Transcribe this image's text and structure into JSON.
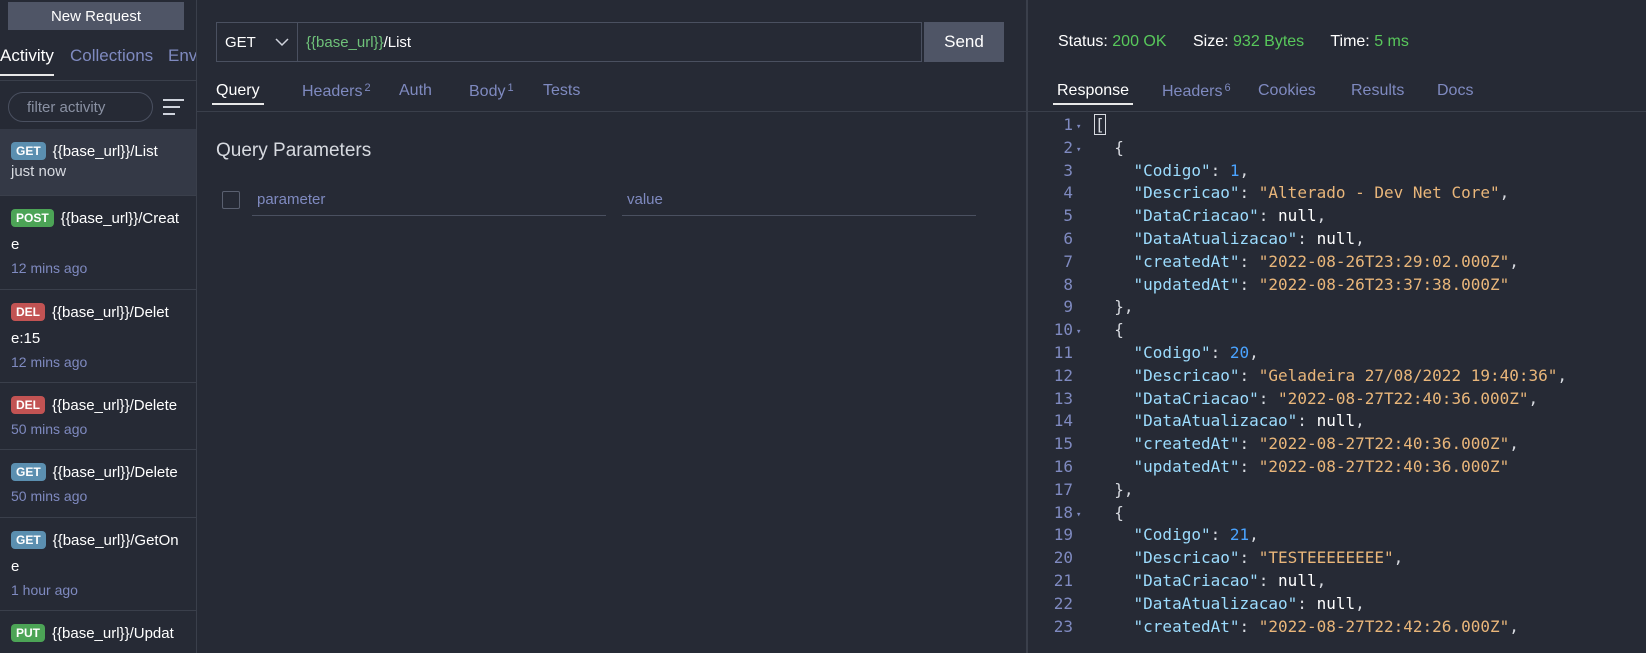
{
  "sidebar": {
    "new_request_label": "New Request",
    "tabs": [
      "Activity",
      "Collections",
      "Env"
    ],
    "filter_placeholder": "filter activity",
    "items": [
      {
        "method": "GET",
        "url": "{{base_url}}/List",
        "time": "just now",
        "color": "#5b8fb0"
      },
      {
        "method": "POST",
        "url": "{{base_url}}/Create",
        "time": "12 mins ago",
        "color": "#4ca456"
      },
      {
        "method": "DEL",
        "url": "{{base_url}}/Delete:15",
        "time": "12 mins ago",
        "color": "#c25353"
      },
      {
        "method": "DEL",
        "url": "{{base_url}}/Delete",
        "time": "50 mins ago",
        "color": "#c25353"
      },
      {
        "method": "GET",
        "url": "{{base_url}}/Delete",
        "time": "50 mins ago",
        "color": "#5b8fb0"
      },
      {
        "method": "GET",
        "url": "{{base_url}}/GetOne",
        "time": "1 hour ago",
        "color": "#5b8fb0"
      },
      {
        "method": "PUT",
        "url": "{{base_url}}/Updat",
        "time": "",
        "color": "#4ca456"
      }
    ]
  },
  "request": {
    "method": "GET",
    "url_variable": "{{base_url}}",
    "url_path": "/List",
    "send_label": "Send",
    "tabs": [
      {
        "label": "Query",
        "count": ""
      },
      {
        "label": "Headers",
        "count": "2"
      },
      {
        "label": "Auth",
        "count": ""
      },
      {
        "label": "Body",
        "count": "1"
      },
      {
        "label": "Tests",
        "count": ""
      }
    ],
    "query_title": "Query Parameters",
    "param_placeholder": "parameter",
    "value_placeholder": "value"
  },
  "response": {
    "status_label": "Status:",
    "status_value": "200 OK",
    "size_label": "Size:",
    "size_value": "932 Bytes",
    "time_label": "Time:",
    "time_value": "5 ms",
    "tabs": [
      {
        "label": "Response",
        "count": ""
      },
      {
        "label": "Headers",
        "count": "6"
      },
      {
        "label": "Cookies",
        "count": ""
      },
      {
        "label": "Results",
        "count": ""
      },
      {
        "label": "Docs",
        "count": ""
      }
    ],
    "body_lines": [
      "[",
      "  {",
      "    \"Codigo\": 1,",
      "    \"Descricao\": \"Alterado - Dev Net Core\",",
      "    \"DataCriacao\": null,",
      "    \"DataAtualizacao\": null,",
      "    \"createdAt\": \"2022-08-26T23:29:02.000Z\",",
      "    \"updatedAt\": \"2022-08-26T23:37:38.000Z\"",
      "  },",
      "  {",
      "    \"Codigo\": 20,",
      "    \"Descricao\": \"Geladeira 27/08/2022 19:40:36\",",
      "    \"DataCriacao\": \"2022-08-27T22:40:36.000Z\",",
      "    \"DataAtualizacao\": null,",
      "    \"createdAt\": \"2022-08-27T22:40:36.000Z\",",
      "    \"updatedAt\": \"2022-08-27T22:40:36.000Z\"",
      "  },",
      "  {",
      "    \"Codigo\": 21,",
      "    \"Descricao\": \"TESTEEEEEEEE\",",
      "    \"DataCriacao\": null,",
      "    \"DataAtualizacao\": null,",
      "    \"createdAt\": \"2022-08-27T22:42:26.000Z\","
    ],
    "fold_lines": [
      1,
      2,
      10,
      18
    ]
  }
}
